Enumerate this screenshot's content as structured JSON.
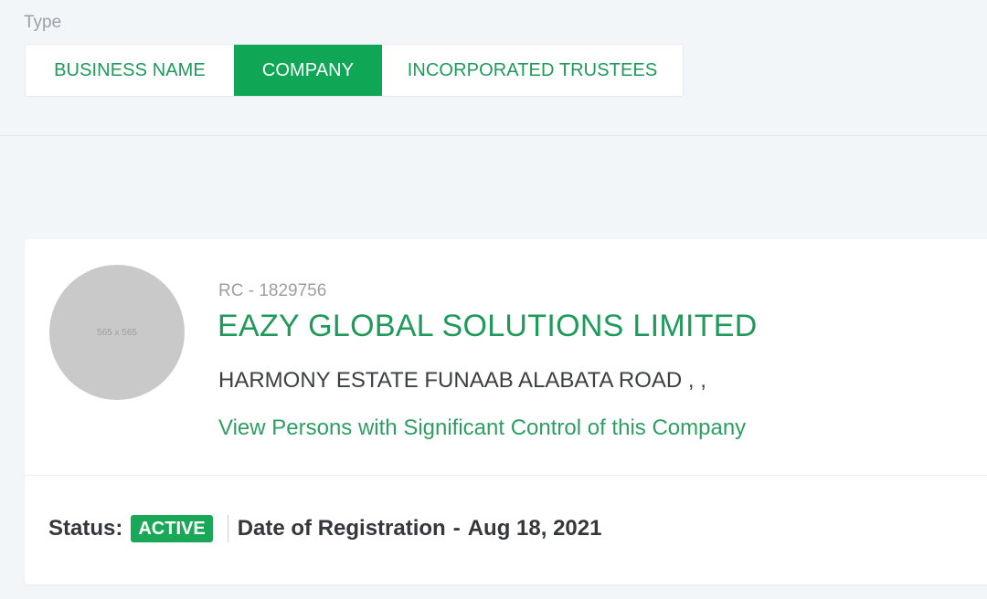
{
  "filter": {
    "type_label": "Type",
    "tabs": [
      {
        "label": "BUSINESS NAME",
        "active": false
      },
      {
        "label": "COMPANY",
        "active": true
      },
      {
        "label": "INCORPORATED TRUSTEES",
        "active": false
      }
    ]
  },
  "result": {
    "avatar_placeholder": "565 x 565",
    "rc_number": "RC - 1829756",
    "company_name": "EAZY GLOBAL SOLUTIONS LIMITED",
    "address": "HARMONY ESTATE FUNAAB ALABATA ROAD , ,",
    "psc_link": "View Persons with Significant Control of this Company",
    "status_label": "Status:",
    "status_value": "ACTIVE",
    "registration_label": "Date of Registration",
    "registration_separator": "-",
    "registration_date": "Aug 18, 2021"
  },
  "colors": {
    "accent": "#0fa656",
    "link": "#2e9e64",
    "background": "#f3f6f9"
  }
}
